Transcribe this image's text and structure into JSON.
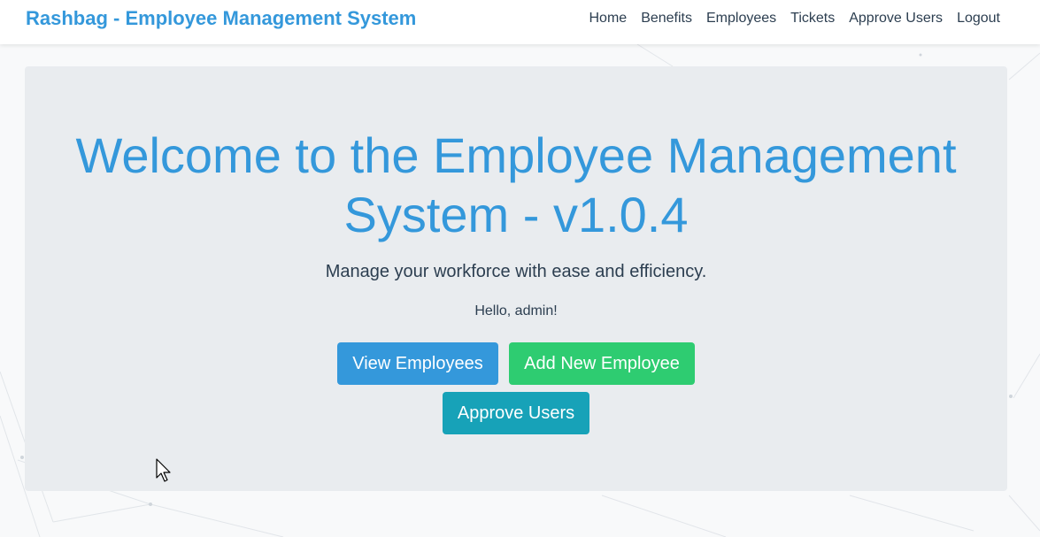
{
  "navbar": {
    "brand": "Rashbag - Employee Management System",
    "links": [
      "Home",
      "Benefits",
      "Employees",
      "Tickets",
      "Approve Users",
      "Logout"
    ]
  },
  "hero": {
    "title_line1": "Welcome to the Employee Management",
    "title_line2": "System - v1.0.4",
    "lead": "Manage your workforce with ease and efficiency.",
    "greeting": "Hello, admin!"
  },
  "buttons": {
    "view_employees": "View Employees",
    "add_employee": "Add New Employee",
    "approve_users": "Approve Users"
  },
  "colors": {
    "primary": "#3498db",
    "success": "#2ecc71",
    "info": "#17a2b8",
    "text": "#2c3e50",
    "jumbotron_bg": "#e9ecef"
  },
  "icons": {
    "cursor": "mouse-pointer-icon"
  }
}
